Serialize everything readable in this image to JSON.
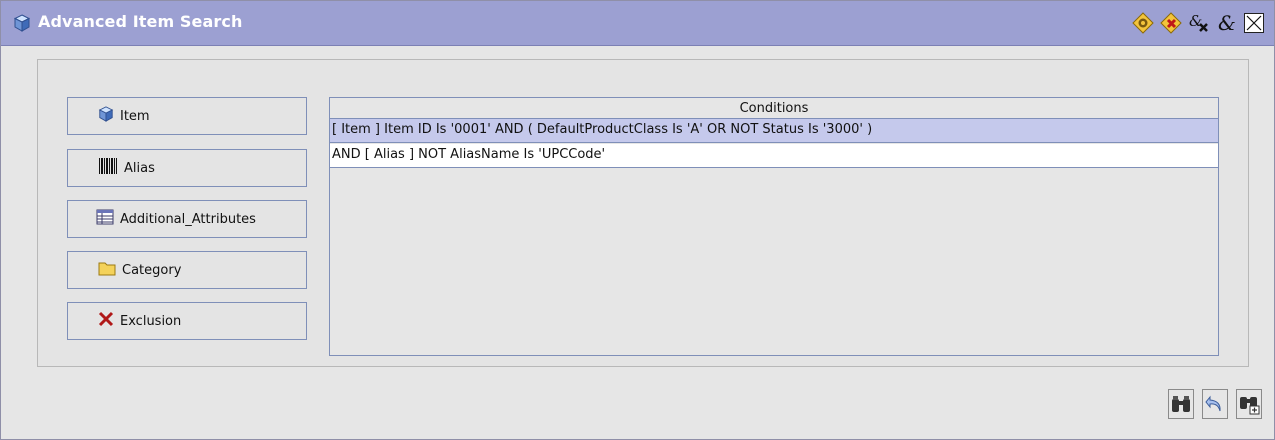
{
  "window": {
    "title": "Advanced Item Search",
    "title_icon": "cube-icon",
    "toolbar_icons": [
      "gear-diamond-icon",
      "delete-diamond-icon",
      "close-group-icon",
      "ampersand-icon",
      "close-icon"
    ]
  },
  "sidebar": {
    "buttons": [
      {
        "label": "Item",
        "icon": "cube-icon"
      },
      {
        "label": "Alias",
        "icon": "barcode-icon"
      },
      {
        "label": "Additional_Attributes",
        "icon": "table-icon"
      },
      {
        "label": "Category",
        "icon": "folder-icon"
      },
      {
        "label": "Exclusion",
        "icon": "x-icon"
      }
    ]
  },
  "conditions": {
    "header": "Conditions",
    "rows": [
      "[ Item ] Item ID Is '0001'  AND ( DefaultProductClass Is 'A'  OR NOT Status Is '3000'  )",
      "AND [ Alias ] NOT AliasName Is 'UPCCode'"
    ]
  },
  "bottom_buttons": [
    "binoculars-icon",
    "undo-icon",
    "binoculars-add-icon"
  ],
  "colors": {
    "titlebar": "#9ca0d2",
    "selected_row": "#c5c9ec",
    "panel": "#e4e4e4"
  }
}
